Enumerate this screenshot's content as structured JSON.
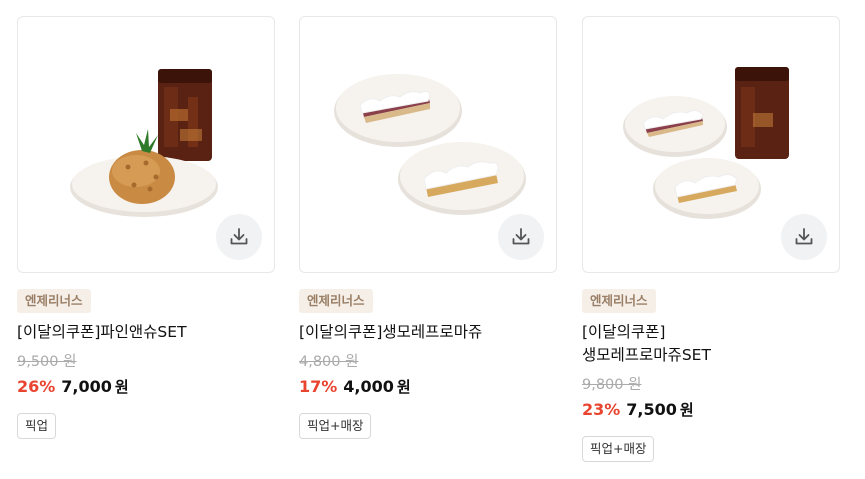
{
  "products": [
    {
      "brand": "엔제리너스",
      "title": "[이달의쿠폰]파인앤슈SET",
      "original_price": "9,500 원",
      "discount": "26%",
      "price": "7,000",
      "currency": "원",
      "tag": "픽업",
      "image_icon": "pineapple-choux-and-iced-coffee-image"
    },
    {
      "brand": "엔제리너스",
      "title": "[이달의쿠폰]생모레프로마쥬",
      "original_price": "4,800 원",
      "discount": "17%",
      "price": "4,000",
      "currency": "원",
      "tag": "픽업+매장",
      "image_icon": "cheesecake-slices-image"
    },
    {
      "brand": "엔제리너스",
      "title": "[이달의쿠폰]\n생모레프로마쥬SET",
      "original_price": "9,800 원",
      "discount": "23%",
      "price": "7,500",
      "currency": "원",
      "tag": "픽업+매장",
      "image_icon": "cheesecake-and-iced-coffee-image"
    }
  ],
  "colors": {
    "discount": "#e8442f",
    "brand_badge_bg": "#f5efe8",
    "brand_badge_text": "#9a7f66"
  }
}
